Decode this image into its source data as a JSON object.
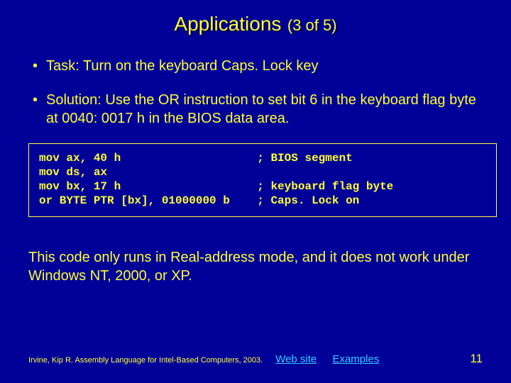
{
  "title": {
    "main": "Applications",
    "sub": "(3 of 5)"
  },
  "bullets": [
    "Task: Turn on the keyboard Caps. Lock key",
    "Solution: Use the OR instruction to set bit 6 in the keyboard flag byte at 0040: 0017 h in the BIOS data area."
  ],
  "code": "mov ax, 40 h                    ; BIOS segment\nmov ds, ax\nmov bx, 17 h                    ; keyboard flag byte\nor BYTE PTR [bx], 01000000 b    ; Caps. Lock on",
  "note": "This code only runs in Real-address mode, and it does not work under Windows NT, 2000, or XP.",
  "footer": {
    "citation": "Irvine, Kip R. Assembly Language for Intel-Based Computers, 2003.",
    "link1": "Web site",
    "link2": "Examples",
    "pagenum": "11"
  }
}
